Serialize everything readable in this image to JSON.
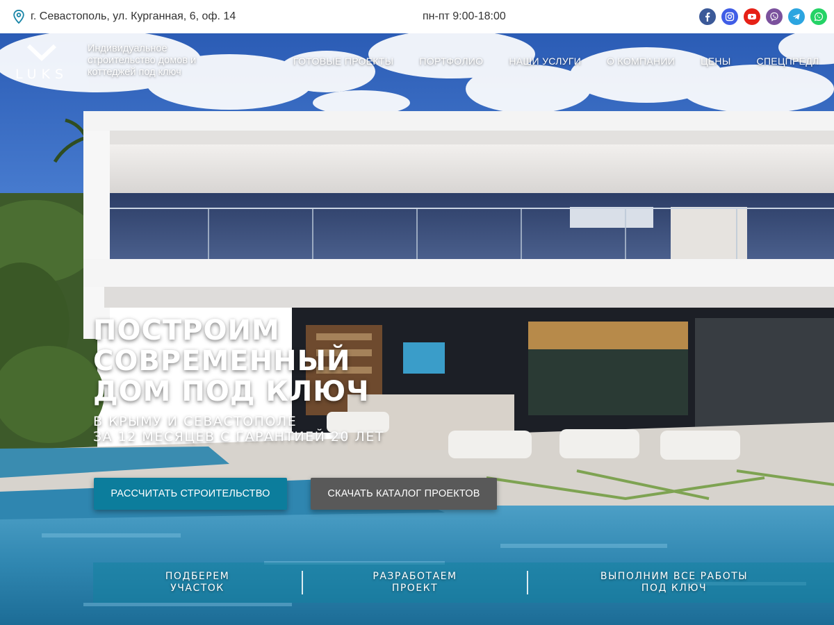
{
  "topbar": {
    "address": "г. Севастополь, ул. Курганная, 6, оф. 14",
    "hours": "пн-пт 9:00-18:00",
    "socials": [
      {
        "name": "facebook-icon",
        "color": "#3b5998"
      },
      {
        "name": "instagram-icon",
        "color": "#405de6"
      },
      {
        "name": "youtube-icon",
        "color": "#e62117"
      },
      {
        "name": "viber-icon",
        "color": "#7b519d"
      },
      {
        "name": "telegram-icon",
        "color": "#2ca5e0"
      },
      {
        "name": "whatsapp-icon",
        "color": "#25d366"
      }
    ]
  },
  "brand": {
    "logo_text": "LUKS",
    "tagline": "Индивидуальное строительство домов и коттеджей под ключ"
  },
  "nav": {
    "items": [
      "ГОТОВЫЕ ПРОЕКТЫ",
      "ПОРТФОЛИО",
      "НАШИ УСЛУГИ",
      "О КОМПАНИИ",
      "ЦЕНЫ",
      "СПЕЦПРЕДЛ"
    ]
  },
  "hero": {
    "headline_lines": [
      "ПОСТРОИМ",
      "СОВРЕМЕННЫЙ",
      "ДОМ ПОД КЛЮЧ"
    ],
    "subline_lines": [
      "В КРЫМУ И СЕВАСТОПОЛЕ",
      "ЗА 12 МЕСЯЦЕВ С ГАРАНТИЕЙ 20 ЛЕТ"
    ],
    "primary_button": "РАССЧИТАТЬ СТРОИТЕЛЬСТВО",
    "secondary_button": "Скачать каталог проектов",
    "secondary_button_display": "СКАЧАТЬ КАТАЛОГ ПРОЕКТОВ"
  },
  "steps": [
    {
      "line1": "ПОДБЕРЕМ",
      "line2": "УЧАСТОК"
    },
    {
      "line1": "РАЗРАБОТАЕМ",
      "line2": "ПРОЕКТ"
    },
    {
      "line1": "ВЫПОЛНИМ ВСЕ РАБОТЫ",
      "line2": "ПОД КЛЮЧ"
    }
  ],
  "colors": {
    "accent": "#0c7d9c",
    "secondary_button": "#595959",
    "sky": "#2f5fb8"
  }
}
